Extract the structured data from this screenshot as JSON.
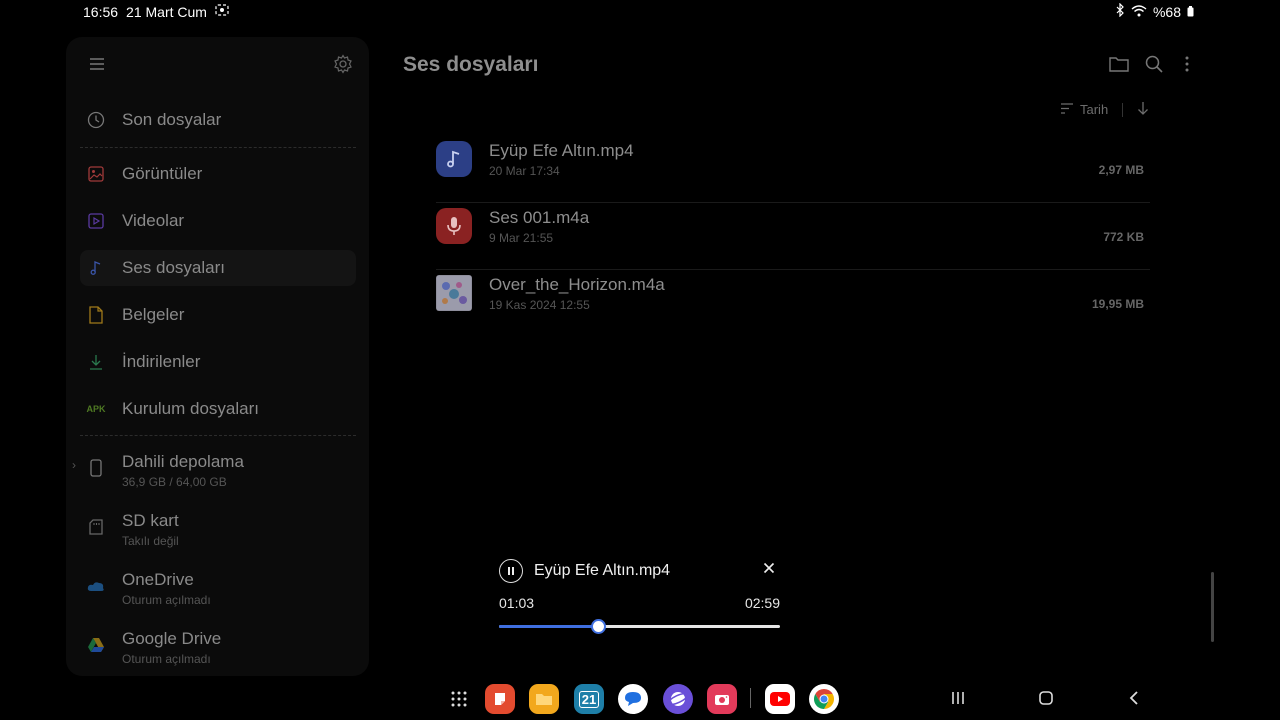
{
  "status_bar": {
    "time": "16:56",
    "date": "21 Mart Cum",
    "battery": "%68"
  },
  "sidebar": {
    "items": [
      {
        "label": "Son dosyalar",
        "icon": "clock-icon"
      },
      {
        "label": "Görüntüler",
        "icon": "image-icon",
        "color": "#c0392b"
      },
      {
        "label": "Videolar",
        "icon": "video-icon",
        "color": "#6a3bb8"
      },
      {
        "label": "Ses dosyaları",
        "icon": "music-note-icon",
        "color": "#3355aa"
      },
      {
        "label": "Belgeler",
        "icon": "document-icon",
        "color": "#b8860b"
      },
      {
        "label": "İndirilenler",
        "icon": "download-icon",
        "color": "#2e8b57"
      },
      {
        "label": "Kurulum dosyaları",
        "icon": "apk-icon",
        "badge": "APK",
        "color": "#5a8a2a"
      }
    ],
    "storage": [
      {
        "label": "Dahili depolama",
        "sub": "36,9 GB / 64,00 GB",
        "icon": "phone-icon"
      },
      {
        "label": "SD kart",
        "sub": "Takılı değil",
        "icon": "sd-card-icon"
      },
      {
        "label": "OneDrive",
        "sub": "Oturum açılmadı",
        "icon": "onedrive-icon"
      },
      {
        "label": "Google Drive",
        "sub": "Oturum açılmadı",
        "icon": "google-drive-icon"
      }
    ]
  },
  "main": {
    "title": "Ses dosyaları",
    "sort_label": "Tarih",
    "files": [
      {
        "name": "Eyüp Efe Altın.mp4",
        "date": "20 Mar 17:34",
        "size": "2,97 MB",
        "thumb": "music-note-icon",
        "color": "#3b5bc4"
      },
      {
        "name": "Ses 001.m4a",
        "date": "9 Mar 21:55",
        "size": "772 KB",
        "thumb": "microphone-icon",
        "color": "#b83232"
      },
      {
        "name": "Over_the_Horizon.m4a",
        "date": "19 Kas 2024 12:55",
        "size": "19,95 MB",
        "thumb": "album-art-icon",
        "color": "#c9c9d6"
      }
    ]
  },
  "player": {
    "title": "Eyüp Efe Altın.mp4",
    "current": "01:03",
    "total": "02:59",
    "progress": 0.352
  },
  "dock": {
    "apps": [
      {
        "name": "all-apps-icon",
        "color": "#000000"
      },
      {
        "name": "samsung-notes-icon",
        "color": "#e34b2f"
      },
      {
        "name": "my-files-icon",
        "color": "#f2a81d"
      },
      {
        "name": "calendar-icon",
        "color": "#1e7fa8"
      },
      {
        "name": "messages-icon",
        "color": "#1f6fe0"
      },
      {
        "name": "internet-icon",
        "color": "#6a4fd8"
      },
      {
        "name": "camera-icon",
        "color": "#e23a5a"
      },
      {
        "name": "youtube-icon",
        "color": "#ff0000"
      },
      {
        "name": "chrome-icon",
        "color": "#ffffff"
      }
    ],
    "calendar_day": "21"
  }
}
